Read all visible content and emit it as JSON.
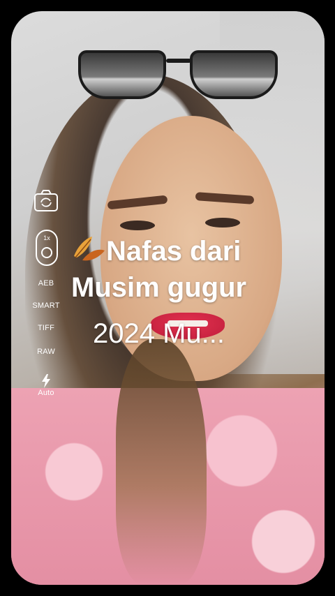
{
  "camera_controls": {
    "zoom_label": "1x",
    "aeb_label": "AEB",
    "smart_label": "SMART",
    "tiff_label": "TIFF",
    "raw_label": "RAW",
    "flash_label": "Auto"
  },
  "caption": {
    "line1": "Nafas dari",
    "line2": "Musim gugur",
    "line3": "2024 Mu..."
  },
  "colors": {
    "control_foreground": "#ffffff",
    "leaf_orange": "#f0922a",
    "leaf_brown": "#b8561c"
  },
  "icons": [
    "camera-switch-icon",
    "zoom-lens-icon",
    "flash-icon",
    "autumn-leaf-icon"
  ]
}
